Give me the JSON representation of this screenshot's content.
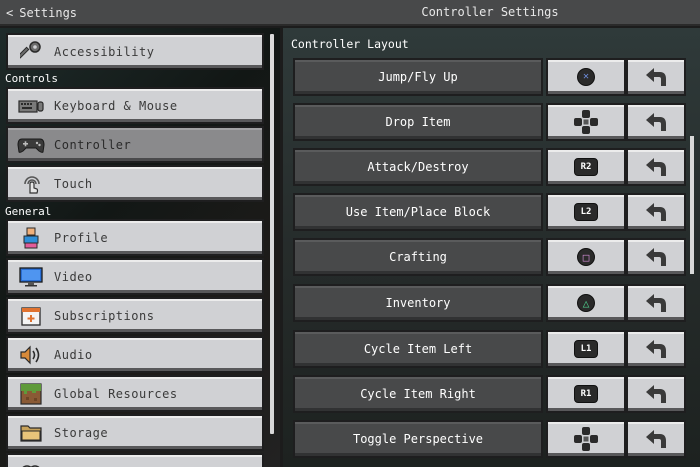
{
  "header": {
    "back_label": "Settings",
    "title": "Controller Settings"
  },
  "sidebar": {
    "top_item": {
      "label": "Accessibility",
      "icon": "key-icon"
    },
    "section_controls": "Controls",
    "controls_items": [
      {
        "label": "Keyboard & Mouse",
        "icon": "keyboard-icon"
      },
      {
        "label": "Controller",
        "icon": "gamepad-icon",
        "active": true
      },
      {
        "label": "Touch",
        "icon": "touch-icon"
      }
    ],
    "section_general": "General",
    "general_items": [
      {
        "label": "Profile",
        "icon": "profile-icon"
      },
      {
        "label": "Video",
        "icon": "monitor-icon"
      },
      {
        "label": "Subscriptions",
        "icon": "calendar-icon"
      },
      {
        "label": "Audio",
        "icon": "speaker-icon"
      },
      {
        "label": "Global Resources",
        "icon": "grass-block-icon"
      },
      {
        "label": "Storage",
        "icon": "folder-icon"
      }
    ]
  },
  "main": {
    "section_title": "Controller Layout",
    "bindings": [
      {
        "action": "Jump/Fly Up",
        "button": "cross",
        "button_text": "✕"
      },
      {
        "action": "Drop Item",
        "button": "dpad",
        "button_text": ""
      },
      {
        "action": "Attack/Destroy",
        "button": "R2",
        "button_text": "R2"
      },
      {
        "action": "Use Item/Place Block",
        "button": "L2",
        "button_text": "L2"
      },
      {
        "action": "Crafting",
        "button": "square",
        "button_text": "□"
      },
      {
        "action": "Inventory",
        "button": "triangle",
        "button_text": "△"
      },
      {
        "action": "Cycle Item Left",
        "button": "L1",
        "button_text": "L1"
      },
      {
        "action": "Cycle Item Right",
        "button": "R1",
        "button_text": "R1"
      },
      {
        "action": "Toggle Perspective",
        "button": "dpad",
        "button_text": ""
      }
    ]
  },
  "colors": {
    "cross": "#6f8ede",
    "square": "#d58fd8",
    "triangle": "#4fd08e"
  }
}
